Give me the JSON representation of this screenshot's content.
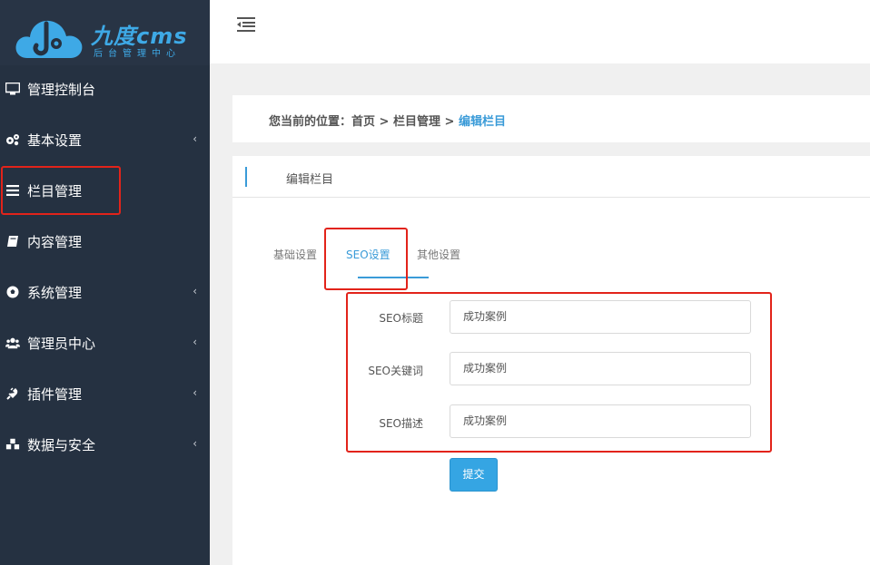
{
  "logo": {
    "title": "九度cms",
    "subtitle": "后台管理中心"
  },
  "sidebar": {
    "items": [
      {
        "label": "管理控制台",
        "icon": "monitor-icon",
        "has_arrow": false
      },
      {
        "label": "基本设置",
        "icon": "gears-icon",
        "has_arrow": true
      },
      {
        "label": "栏目管理",
        "icon": "list-icon",
        "has_arrow": false
      },
      {
        "label": "内容管理",
        "icon": "book-icon",
        "has_arrow": false
      },
      {
        "label": "系统管理",
        "icon": "soccer-ball-icon",
        "has_arrow": true
      },
      {
        "label": "管理员中心",
        "icon": "users-icon",
        "has_arrow": true
      },
      {
        "label": "插件管理",
        "icon": "plug-icon",
        "has_arrow": true
      },
      {
        "label": "数据与安全",
        "icon": "cubes-icon",
        "has_arrow": true
      }
    ],
    "arrow_glyph": "‹"
  },
  "breadcrumb": {
    "prefix": "您当前的位置：",
    "home": "首页",
    "sep1": " > ",
    "section": "栏目管理",
    "sep2": " > ",
    "current": "编辑栏目"
  },
  "panel": {
    "title": "编辑栏目"
  },
  "tabs": [
    {
      "label": "基础设置",
      "active": false
    },
    {
      "label": "SEO设置",
      "active": true
    },
    {
      "label": "其他设置",
      "active": false
    }
  ],
  "form": {
    "fields": [
      {
        "label": "SEO标题",
        "value": "成功案例"
      },
      {
        "label": "SEO关键词",
        "value": "成功案例"
      },
      {
        "label": "SEO描述",
        "value": "成功案例"
      }
    ],
    "submit_label": "提交"
  },
  "colors": {
    "sidebar_bg": "#253141",
    "accent": "#3a9bd8",
    "button": "#35a5e3",
    "highlight": "#e2231a"
  }
}
